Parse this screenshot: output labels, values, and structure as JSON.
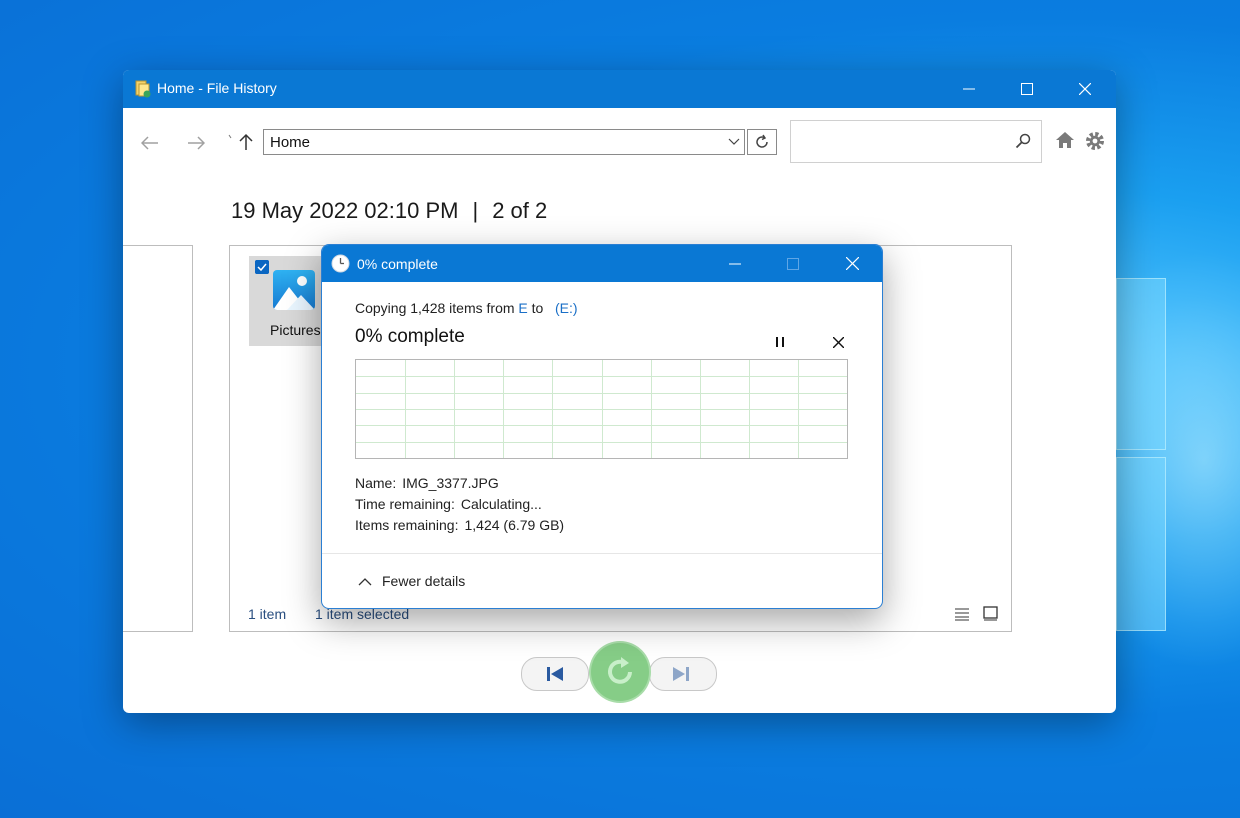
{
  "main_window": {
    "title": "Home - File History",
    "address": "Home",
    "search_placeholder": "",
    "date_time": "19 May 2022 02:10 PM",
    "separator": "|",
    "version_position": "2 of 2",
    "folder": {
      "label": "Pictures",
      "selected": true
    },
    "status": {
      "item_count": "1 item",
      "selection": "1 item selected"
    }
  },
  "dialog": {
    "title": "0% complete",
    "copy_prefix": "Copying 1,428 items from",
    "source": "E",
    "to_word": "to",
    "destination": "(E:)",
    "progress_text": "0% complete",
    "progress_fraction": 0,
    "details": [
      {
        "label": "Name:",
        "value": "IMG_3377.JPG"
      },
      {
        "label": "Time remaining:",
        "value": "Calculating..."
      },
      {
        "label": "Items remaining:",
        "value": "1,424 (6.79 GB)"
      }
    ],
    "fewer_details": "Fewer details"
  },
  "colors": {
    "titlebar": "#0a78d4",
    "restore_button": "#86cd87",
    "link": "#1a6fc7",
    "graph_grid": "#cfe9cf"
  },
  "icons": {
    "back": "back-arrow-icon",
    "forward": "forward-arrow-icon",
    "up": "up-arrow-icon",
    "refresh": "refresh-icon",
    "search": "search-icon",
    "home": "home-icon",
    "settings": "gear-icon",
    "restore": "restore-icon"
  }
}
